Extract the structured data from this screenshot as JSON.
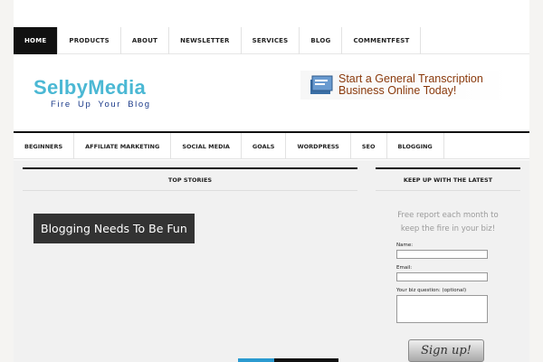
{
  "top_nav": [
    "HOME",
    "PRODUCTS",
    "ABOUT",
    "NEWSLETTER",
    "SERVICES",
    "BLOG",
    "COMMENTFEST"
  ],
  "header": {
    "logo": "SelbyMedia",
    "tagline": "Fire Up Your Blog",
    "ad_line1": "Start a General Transcription",
    "ad_line2": "Business Online Today!",
    "ad_icon": "transcription-ad-icon"
  },
  "sub_nav": [
    "BEGINNERS",
    "AFFILIATE MARKETING",
    "SOCIAL MEDIA",
    "GOALS",
    "WORDPRESS",
    "SEO",
    "BLOGGING"
  ],
  "main": {
    "section_title": "TOP STORIES",
    "feature_title": "Blogging Needs To Be Fun"
  },
  "sidebar": {
    "section_title": "KEEP UP WITH THE LATEST",
    "free_report_line1": "Free report each month to",
    "free_report_line2": "keep the fire in your biz!",
    "name_label": "Name:",
    "email_label": "Email:",
    "question_label": "Your biz question: (optional)",
    "signup_label": "Sign up!"
  },
  "colors": {
    "accent": "#4bb8d4",
    "nav_active": "#111111",
    "slider_accent": "#2b9ad0",
    "ad_text": "#8a3a0c"
  }
}
